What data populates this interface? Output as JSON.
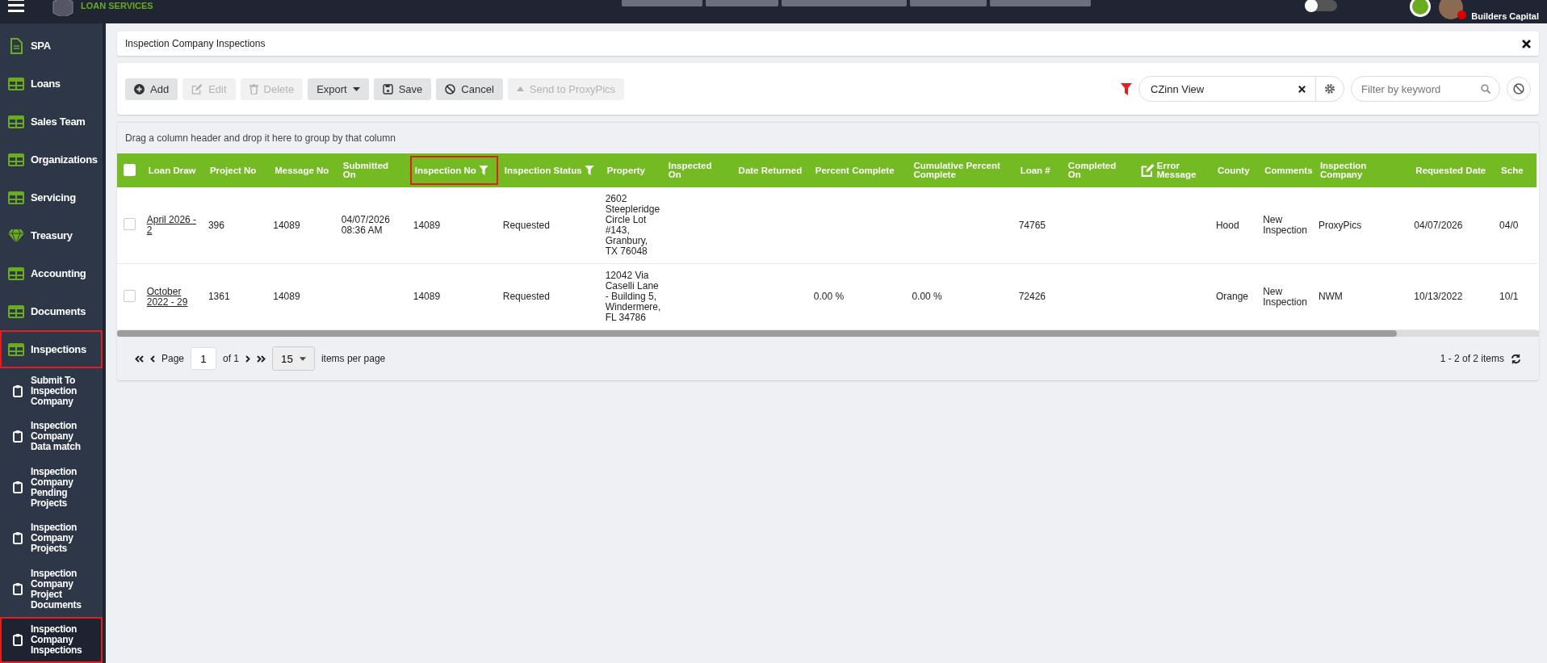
{
  "top_bar": {
    "logo_text": "LOAN SERVICES",
    "user": "Builders Capital",
    "toggle_on": false
  },
  "sidebar": {
    "items": [
      {
        "label": "SPA",
        "selected": false,
        "highlighted": false
      },
      {
        "label": "Loans",
        "selected": false,
        "highlighted": false
      },
      {
        "label": "Sales Team",
        "selected": false,
        "highlighted": false
      },
      {
        "label": "Organizations",
        "selected": false,
        "highlighted": false
      },
      {
        "label": "Servicing",
        "selected": false,
        "highlighted": false
      },
      {
        "label": "Treasury",
        "selected": false,
        "highlighted": false
      },
      {
        "label": "Accounting",
        "selected": false,
        "highlighted": false
      },
      {
        "label": "Documents",
        "selected": false,
        "highlighted": false
      },
      {
        "label": "Inspections",
        "selected": false,
        "highlighted": true,
        "children": [
          {
            "label": "Submit To Inspection Company",
            "selected": false,
            "highlighted": false
          },
          {
            "label": "Inspection Company Data match",
            "selected": false,
            "highlighted": false
          },
          {
            "label": "Inspection Company Pending Projects",
            "selected": false,
            "highlighted": false
          },
          {
            "label": "Inspection Company Projects",
            "selected": false,
            "highlighted": false
          },
          {
            "label": "Inspection Company Project Documents",
            "selected": false,
            "highlighted": false
          },
          {
            "label": "Inspection Company Inspections",
            "selected": true,
            "highlighted": true
          }
        ]
      }
    ]
  },
  "panel_title": "Inspection Company Inspections",
  "toolbar": {
    "buttons": [
      {
        "label": "Add",
        "disabled": false
      },
      {
        "label": "Edit",
        "disabled": true
      },
      {
        "label": "Delete",
        "disabled": true
      },
      {
        "label": "Export",
        "disabled": false
      },
      {
        "label": "Save",
        "disabled": false
      },
      {
        "label": "Cancel",
        "disabled": false
      },
      {
        "label": "Send to ProxyPics",
        "disabled": true
      }
    ],
    "view": "CZinn View",
    "keyword_placeholder": "Filter by keyword"
  },
  "group_hint": "Drag a column header and drop it here to group by that column",
  "table": {
    "all_checked": false,
    "columns": [
      {
        "label": "Loan Draw",
        "filtered": false,
        "highlighted": false,
        "icon": false
      },
      {
        "label": "Project No",
        "filtered": false,
        "highlighted": false,
        "icon": false
      },
      {
        "label": "Message No",
        "filtered": false,
        "highlighted": false,
        "icon": false
      },
      {
        "label": "Submitted On",
        "filtered": false,
        "highlighted": false,
        "icon": false
      },
      {
        "label": "Inspection No",
        "filtered": true,
        "highlighted": true,
        "icon": false
      },
      {
        "label": "Inspection Status",
        "filtered": true,
        "highlighted": false,
        "icon": false
      },
      {
        "label": "Property",
        "filtered": false,
        "highlighted": false,
        "icon": false
      },
      {
        "label": "Inspected On",
        "filtered": false,
        "highlighted": false,
        "icon": false
      },
      {
        "label": "Date Returned",
        "filtered": false,
        "highlighted": false,
        "icon": false
      },
      {
        "label": "Percent Complete",
        "filtered": false,
        "highlighted": false,
        "icon": false
      },
      {
        "label": "Cumulative Percent Complete",
        "filtered": false,
        "highlighted": false,
        "icon": false
      },
      {
        "label": "Loan #",
        "filtered": false,
        "highlighted": false,
        "icon": false
      },
      {
        "label": "Completed On",
        "filtered": false,
        "highlighted": false,
        "icon": false
      },
      {
        "label": "Error Message",
        "filtered": false,
        "highlighted": false,
        "icon": true
      },
      {
        "label": "County",
        "filtered": false,
        "highlighted": false,
        "icon": false
      },
      {
        "label": "Comments",
        "filtered": false,
        "highlighted": false,
        "icon": false
      },
      {
        "label": "Inspection Company",
        "filtered": false,
        "highlighted": false,
        "icon": false
      },
      {
        "label": "Requested Date",
        "filtered": false,
        "highlighted": false,
        "icon": false
      },
      {
        "label": "Sche",
        "filtered": false,
        "highlighted": false,
        "icon": false
      }
    ],
    "rows": [
      {
        "checked": false,
        "cells": [
          "April 2026 - 2",
          "396",
          "14089",
          "04/07/2026 08:36 AM",
          "14089",
          "Requested",
          "2602 Steepleridge Circle Lot #143, Granbury, TX 76048",
          "",
          "",
          "",
          "",
          "74765",
          "",
          "",
          "Hood",
          "New Inspection",
          "ProxyPics",
          "04/07/2026",
          "04/0"
        ]
      },
      {
        "checked": false,
        "cells": [
          "October 2022 - 29",
          "1361",
          "14089",
          "",
          "14089",
          "Requested",
          "12042 Via Caselli Lane - Building 5, Windermere, FL 34786",
          "",
          "",
          "0.00 %",
          "0.00 %",
          "72426",
          "",
          "",
          "Orange",
          "New Inspection",
          "NWM",
          "10/13/2022",
          "10/1"
        ]
      }
    ]
  },
  "pager": {
    "page": "1",
    "label_page": "Page",
    "of": "of 1",
    "page_size": "15",
    "per_page": "items per page",
    "summary": "1 - 2 of 2 items"
  }
}
